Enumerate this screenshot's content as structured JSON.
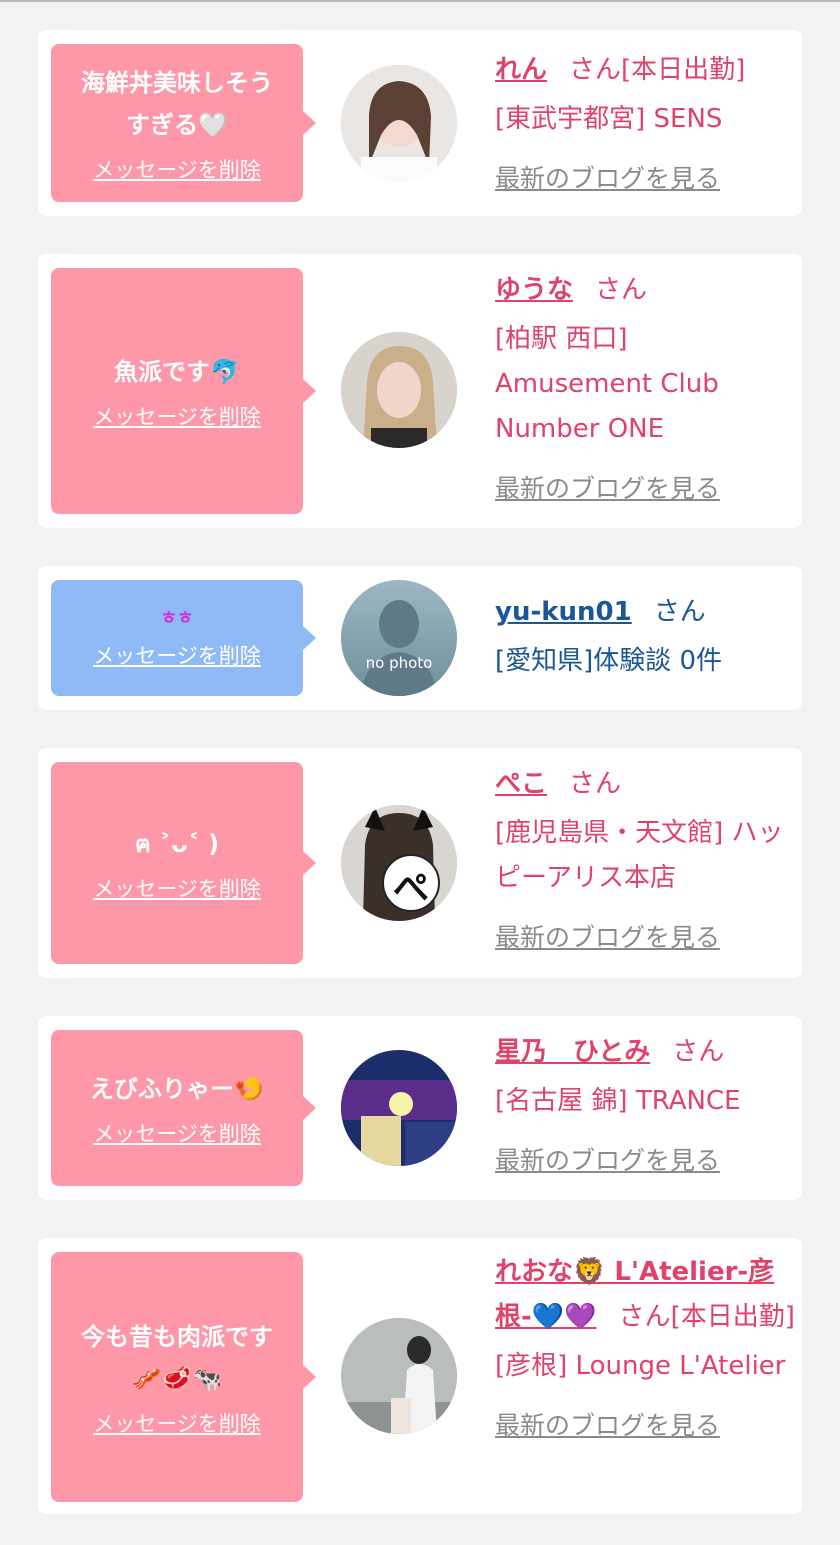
{
  "delete_label": "メッセージを削除",
  "san_label": "さん",
  "blog_label": "最新のブログを見る",
  "cards": [
    {
      "message": "海鮮丼美味しそうすぎる🤍",
      "name": "れん",
      "status": "[本日出勤]",
      "shop": "[東武宇都宮] SENS",
      "theme": "pink"
    },
    {
      "message": "魚派です🐬",
      "name": "ゆうな",
      "status": "",
      "shop": "[柏駅 西口] Amusement Club Number ONE",
      "theme": "pink"
    },
    {
      "message": "ㅎㅎ",
      "name": "yu-kun01",
      "status": "",
      "shop": "[愛知県]体験談 0件",
      "theme": "blue",
      "avatar_text": "no photo"
    },
    {
      "message": "ฅ ˃ᴗ˂ )",
      "name": "ぺこ",
      "status": "",
      "shop": "[鹿児島県・天文館] ハッピーアリス本店",
      "theme": "pink",
      "avatar_text": "ぺ"
    },
    {
      "message": "えびふりゃー🍤",
      "name": "星乃　ひとみ",
      "status": "",
      "shop": "[名古屋 錦] TRANCE",
      "theme": "pink"
    },
    {
      "message": "今も昔も肉派です🥓🥩🐄",
      "name": "れおな🦁 L'Atelier-彦根-💙💜",
      "status": "[本日出勤]",
      "shop": "[彦根] Lounge L'Atelier",
      "theme": "pink"
    }
  ],
  "colors": {
    "pink_bubble": "#fe97a8",
    "blue_bubble": "#8fbaf5",
    "pink_text": "#e0426a",
    "blue_text": "#1a5796"
  }
}
